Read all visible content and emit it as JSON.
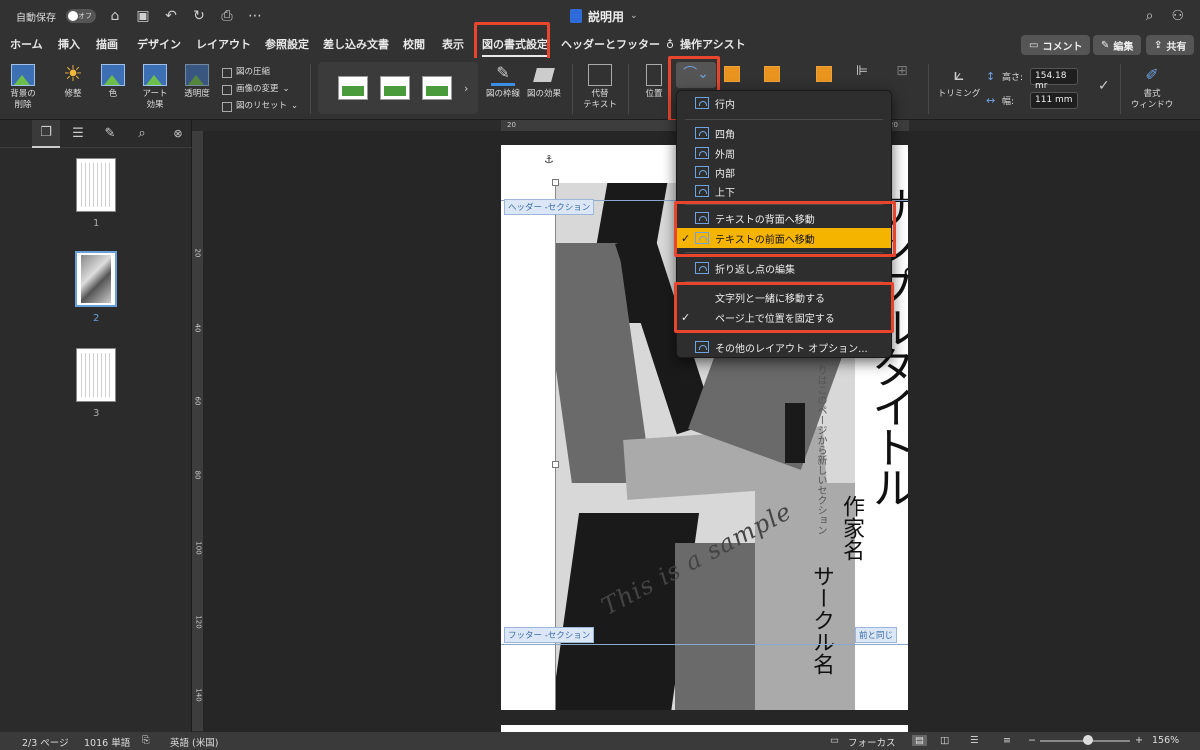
{
  "titlebar": {
    "autosave_label": "自動保存",
    "autosave_state": "オフ",
    "doc_title": "説明用"
  },
  "tabs": [
    {
      "label": "ホーム"
    },
    {
      "label": "挿入"
    },
    {
      "label": "描画"
    },
    {
      "label": "デザイン"
    },
    {
      "label": "レイアウト"
    },
    {
      "label": "参照設定"
    },
    {
      "label": "差し込み文書"
    },
    {
      "label": "校閲"
    },
    {
      "label": "表示"
    },
    {
      "label": "図の書式設定"
    },
    {
      "label": "ヘッダーとフッター"
    },
    {
      "label": "操作アシスト"
    }
  ],
  "tab_buttons": {
    "comment": "コメント",
    "edit": "編集",
    "share": "共有"
  },
  "ribbon": {
    "remove_bg": "背景の\n削除",
    "corrections": "修整",
    "color": "色",
    "art_effects": "アート\n効果",
    "transparency": "透明度",
    "compress": "図の圧縮",
    "change_picture": "画像の変更",
    "reset_picture": "図のリセット",
    "picture_border": "図の枠線",
    "picture_effects": "図の効果",
    "alt_text": "代替\nテキスト",
    "position": "位置",
    "crop": "トリミング",
    "height_label": "高さ:",
    "height_value": "154.18 mr",
    "width_label": "幅:",
    "width_value": "111 mm",
    "format_pane": "書式\nウィンドウ"
  },
  "menu": {
    "items": [
      {
        "label": "行内"
      },
      {
        "label": "四角"
      },
      {
        "label": "外周"
      },
      {
        "label": "内部"
      },
      {
        "label": "上下"
      },
      {
        "label": "テキストの背面へ移動"
      },
      {
        "label": "テキストの前面へ移動",
        "checked": true
      },
      {
        "label": "折り返し点の編集"
      },
      {
        "label": "文字列と一緒に移動する"
      },
      {
        "label": "ページ上で位置を固定する",
        "checked": true
      },
      {
        "label": "その他のレイアウト オプション..."
      }
    ]
  },
  "document": {
    "header_tag": "ヘッダー -セクション",
    "footer_tag": "フッター -セクション",
    "same_as_prev": "前と同じ",
    "author_text": "作家名",
    "circle_text": "サークル名",
    "title_chars": "サンプルタイトル",
    "vertical_note": "りはこのページから新しいセクション",
    "script_text": "This is a sample"
  },
  "left_panel": {
    "pages": [
      "1",
      "2",
      "3"
    ]
  },
  "rulers": {
    "top": [
      "20",
      "20"
    ],
    "left": [
      "20",
      "40",
      "60",
      "80",
      "100",
      "120",
      "140"
    ]
  },
  "status": {
    "page": "2/3 ページ",
    "words": "1016 単語",
    "language": "英語 (米国)",
    "focus": "フォーカス",
    "zoom": "156%"
  },
  "colors": {
    "highlight_red": "#e8452c",
    "menu_selected": "#f5b400"
  }
}
